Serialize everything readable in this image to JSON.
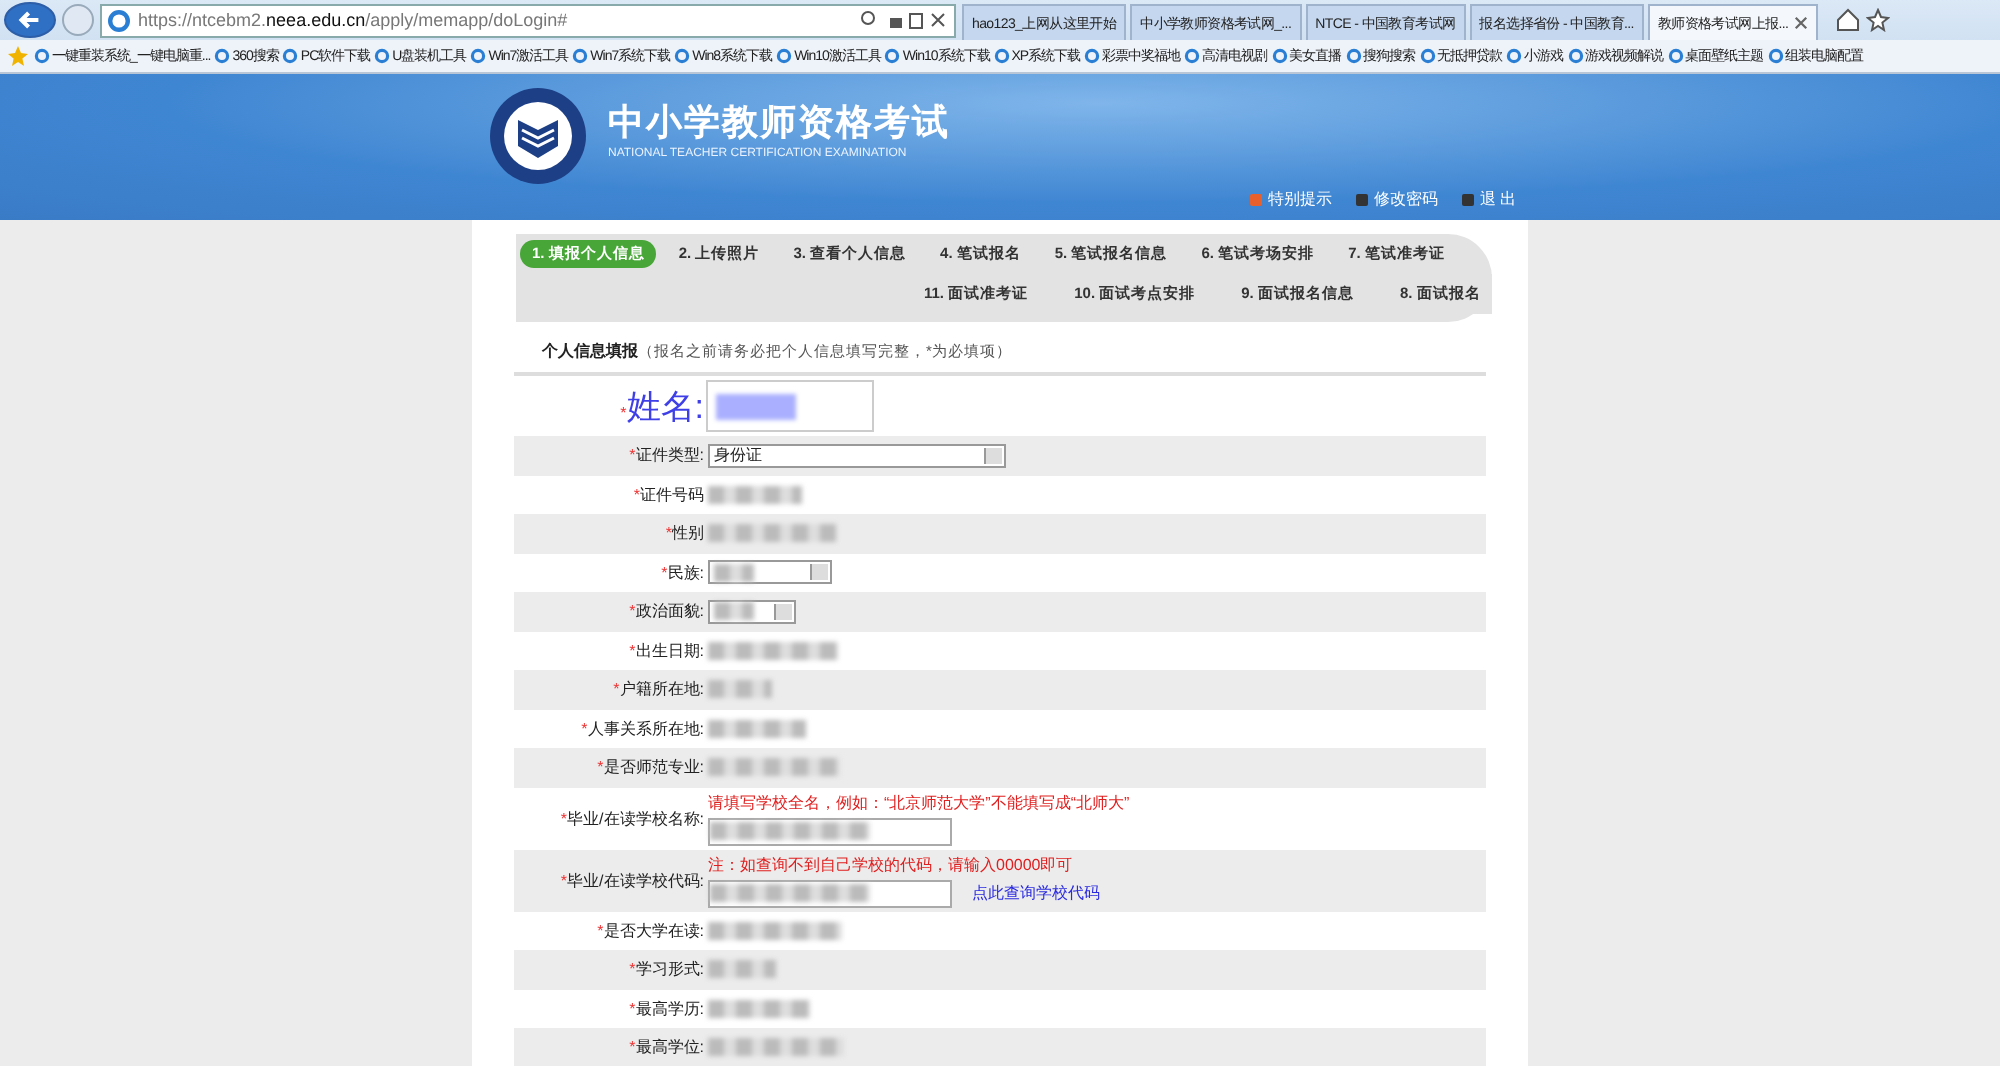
{
  "browser": {
    "address": "https://ntcebm2.**neea.edu.cn**/apply/memapp/doLogin#",
    "tabs": [
      {
        "title": "hao123_上网从这里开始",
        "selected": false
      },
      {
        "title": "中小学教师资格考试网_...",
        "selected": false
      },
      {
        "title": "NTCE - 中国教育考试网",
        "selected": false
      },
      {
        "title": "报名选择省份 - 中国教育...",
        "selected": false
      },
      {
        "title": "教师资格考试网上报...",
        "selected": true
      }
    ],
    "favorites": [
      "一键重装系统_一键电脑重...",
      "360搜索",
      "PC软件下载",
      "U盘装机工具",
      "Win7激活工具",
      "Win7系统下载",
      "Win8系统下载",
      "Win10激活工具",
      "Win10系统下载",
      "XP系统下载",
      "彩票中奖福地",
      "高清电视剧",
      "美女直播",
      "搜狗搜索",
      "无抵押贷款",
      "小游戏",
      "游戏视频解说",
      "桌面壁纸主题",
      "组装电脑配置"
    ]
  },
  "header": {
    "title": "中小学教师资格考试",
    "subtitle": "NATIONAL TEACHER CERTIFICATION EXAMINATION",
    "links": [
      "特别提示",
      "修改密码",
      "退 出"
    ]
  },
  "steps": {
    "top": [
      {
        "label": "1. 填报个人信息",
        "selected": true
      },
      {
        "label": "2. 上传照片",
        "selected": false
      },
      {
        "label": "3. 查看个人信息",
        "selected": false
      },
      {
        "label": "4. 笔试报名",
        "selected": false
      },
      {
        "label": "5. 笔试报名信息",
        "selected": false
      },
      {
        "label": "6. 笔试考场安排",
        "selected": false
      },
      {
        "label": "7. 笔试准考证",
        "selected": false
      }
    ],
    "bottom": [
      {
        "label": "11. 面试准考证",
        "selected": false
      },
      {
        "label": "10. 面试考点安排",
        "selected": false
      },
      {
        "label": "9. 面试报名信息",
        "selected": false
      },
      {
        "label": "8. 面试报名",
        "selected": false
      }
    ]
  },
  "form": {
    "heading": "个人信息填报",
    "required_mark": "*",
    "note": "（报名之前请务必把个人信息填写完整，*为必填项）",
    "name_label": "姓名:",
    "rows": [
      {
        "label": "证件类型:",
        "kind": "select",
        "value": "身份证"
      },
      {
        "label": "证件号码",
        "kind": "blurred"
      },
      {
        "label": "性别",
        "kind": "blurred"
      },
      {
        "label": "民族:",
        "kind": "select-blurred"
      },
      {
        "label": "政治面貌:",
        "kind": "select-blurred"
      },
      {
        "label": "出生日期:",
        "kind": "blurred"
      },
      {
        "label": "户籍所在地:",
        "kind": "blurred"
      },
      {
        "label": "人事关系所在地:",
        "kind": "blurred"
      },
      {
        "label": "是否师范专业:",
        "kind": "blurred"
      },
      {
        "label": "毕业/在读学校名称:",
        "kind": "input-blurred",
        "hint": "请填写学校全名，例如：“北京师范大学”不能填写成“北师大”"
      },
      {
        "label": "毕业/在读学校代码:",
        "kind": "input-blurred",
        "hint": "注：如查询不到自己学校的代码，请输入00000即可",
        "link": "点此查询学校代码"
      },
      {
        "label": "是否大学在读:",
        "kind": "blurred"
      },
      {
        "label": "学习形式:",
        "kind": "blurred"
      },
      {
        "label": "最高学历:",
        "kind": "blurred"
      },
      {
        "label": "最高学位:",
        "kind": "blurred"
      }
    ]
  }
}
